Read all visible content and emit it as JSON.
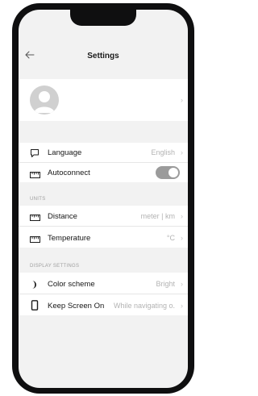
{
  "header": {
    "title": "Settings"
  },
  "language": {
    "label": "Language",
    "value": "English"
  },
  "autoconnect": {
    "label": "Autoconnect",
    "enabled": true
  },
  "units": {
    "section_label": "UNITS",
    "distance": {
      "label": "Distance",
      "value": "meter | km"
    },
    "temperature": {
      "label": "Temperature",
      "value": "°C"
    }
  },
  "display": {
    "section_label": "DISPLAY SETTINGS",
    "color_scheme": {
      "label": "Color scheme",
      "value": "Bright"
    },
    "keep_screen_on": {
      "label": "Keep Screen On",
      "value": "While navigating o..."
    }
  },
  "chevron": "›"
}
